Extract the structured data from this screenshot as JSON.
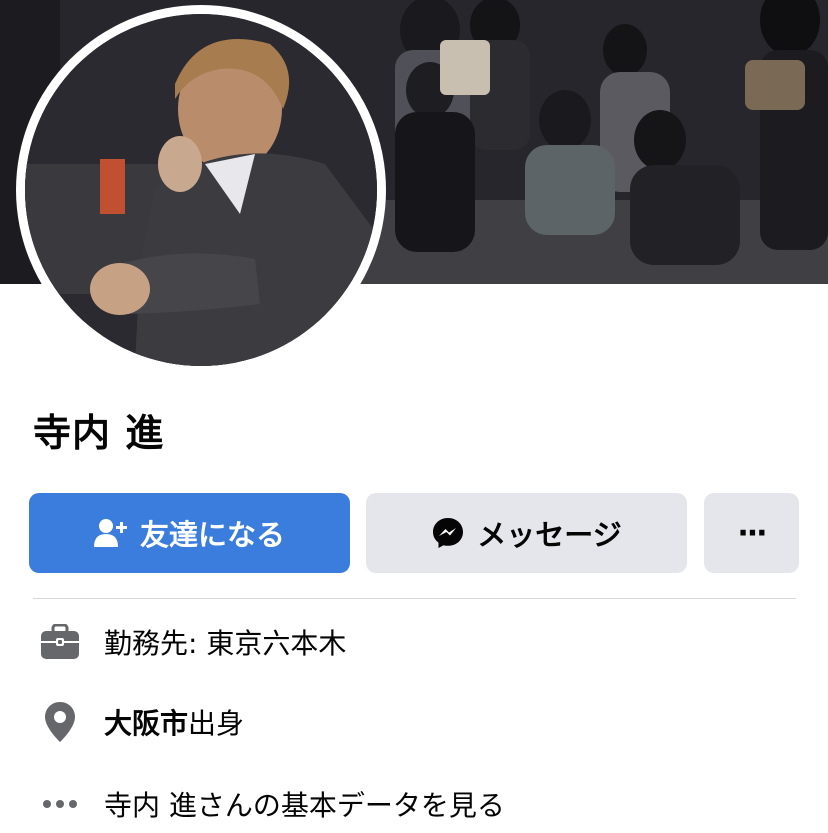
{
  "profile": {
    "name": "寺内 進"
  },
  "actions": {
    "add_friend_label": "友達になる",
    "message_label": "メッセージ",
    "more_label": "···"
  },
  "info": {
    "work": "勤務先: 東京六本木",
    "hometown_city": "大阪市",
    "hometown_suffix": "出身",
    "see_about": "寺内 進さんの基本データを見る"
  },
  "icons": {
    "add_friend": "add-friend-icon",
    "messenger": "messenger-icon",
    "more": "more-icon",
    "work": "briefcase-icon",
    "location": "location-pin-icon",
    "ellipsis": "ellipsis-icon"
  },
  "colors": {
    "primary": "#3b7ddd",
    "secondary_button": "#e4e6eb",
    "icon_gray": "#65676b"
  }
}
